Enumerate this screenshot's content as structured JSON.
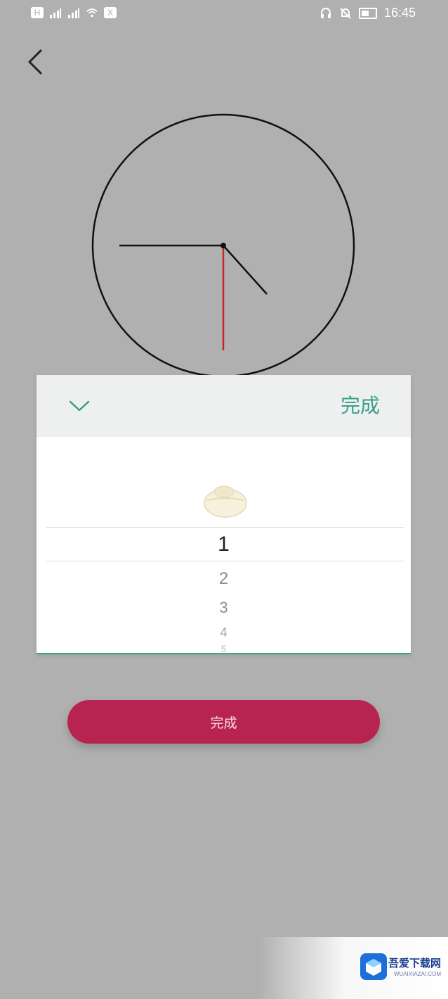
{
  "status_bar": {
    "time": "16:45"
  },
  "picker": {
    "done_label": "完成",
    "items": [
      "1",
      "2",
      "3",
      "4",
      "5"
    ],
    "selected": "1"
  },
  "bottom": {
    "done_label": "完成"
  },
  "watermark": {
    "brand": "吾爱下载网",
    "url": "WUAIXIAZAI.COM"
  },
  "colors": {
    "background": "#b0b0b0",
    "accent_green": "#3b9e89",
    "button_red": "#b72451",
    "second_hand": "#c62828"
  }
}
